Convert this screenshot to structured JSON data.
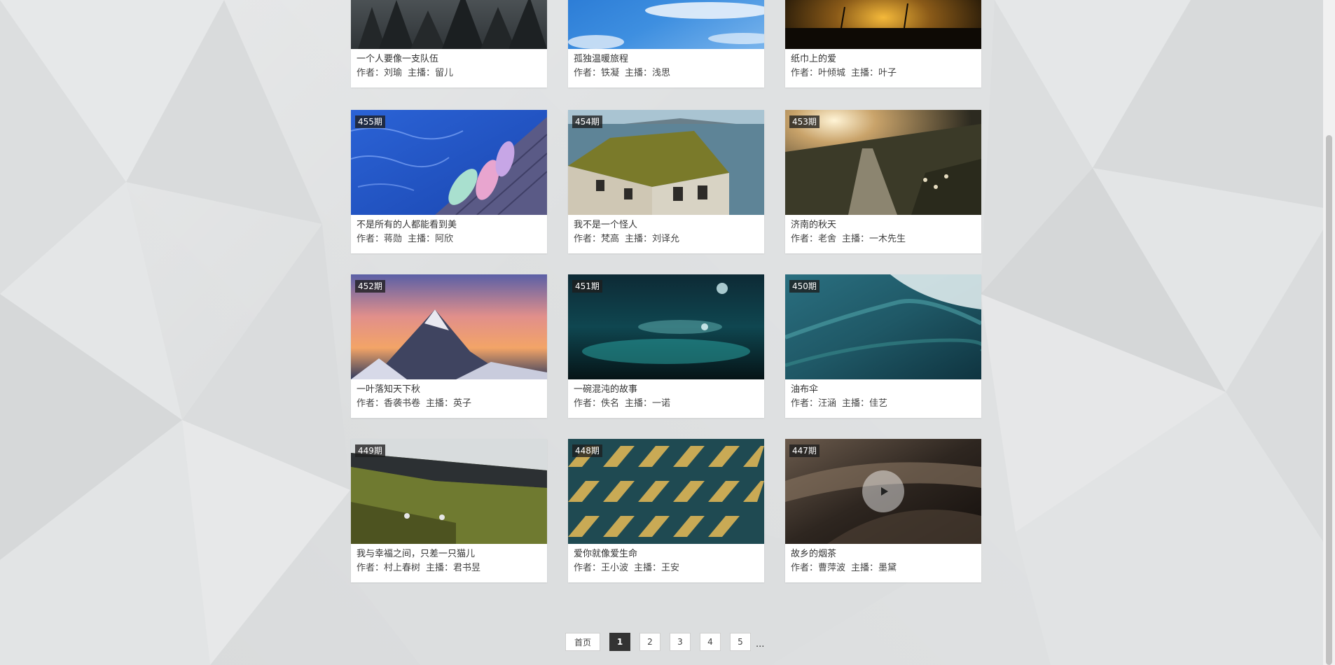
{
  "cards": [
    {
      "title": "一个人要像一支队伍",
      "author": "作者：刘瑜",
      "host": "主播：留儿",
      "issue": "",
      "thumb": "forest"
    },
    {
      "title": "孤独温暖旅程",
      "author": "作者：铁凝",
      "host": "主播：浅思",
      "issue": "",
      "thumb": "sky"
    },
    {
      "title": "纸巾上的爱",
      "author": "作者：叶倾城",
      "host": "主播：叶子",
      "issue": "",
      "thumb": "sunset-field"
    },
    {
      "title": "不是所有的人都能看到美",
      "author": "作者：蒋勋",
      "host": "主播：阿欣",
      "issue": "455期",
      "thumb": "pool"
    },
    {
      "title": "我不是一个怪人",
      "author": "作者：梵高",
      "host": "主播：刘译允",
      "issue": "454期",
      "thumb": "house"
    },
    {
      "title": "济南的秋天",
      "author": "作者：老舍",
      "host": "主播：一木先生",
      "issue": "453期",
      "thumb": "path"
    },
    {
      "title": "一叶落知天下秋",
      "author": "作者：香袭书卷",
      "host": "主播：英子",
      "issue": "452期",
      "thumb": "mountain"
    },
    {
      "title": "一碗混沌的故事",
      "author": "作者：佚名",
      "host": "主播：一诺",
      "issue": "451期",
      "thumb": "water-drops"
    },
    {
      "title": "油布伞",
      "author": "作者：汪涵",
      "host": "主播：佳艺",
      "issue": "450期",
      "thumb": "ocean"
    },
    {
      "title": "我与幸福之间，只差一只猫儿",
      "author": "作者：村上春树",
      "host": "主播：君书昱",
      "issue": "449期",
      "thumb": "coast"
    },
    {
      "title": "爱你就像爱生命",
      "author": "作者：王小波",
      "host": "主播：王安",
      "issue": "448期",
      "thumb": "building"
    },
    {
      "title": "故乡的烟茶",
      "author": "作者：曹萍波",
      "host": "主播：墨黛",
      "issue": "447期",
      "thumb": "dunes",
      "has_play": true
    }
  ],
  "pagination": {
    "home_label": "首页",
    "pages": [
      "1",
      "2",
      "3",
      "4",
      "5"
    ],
    "active": "1",
    "ellipsis": "..."
  },
  "colors": {
    "background": "#dfe1e2",
    "card": "#ffffff",
    "badge": "#1e1e1e",
    "active_page": "#333333"
  }
}
